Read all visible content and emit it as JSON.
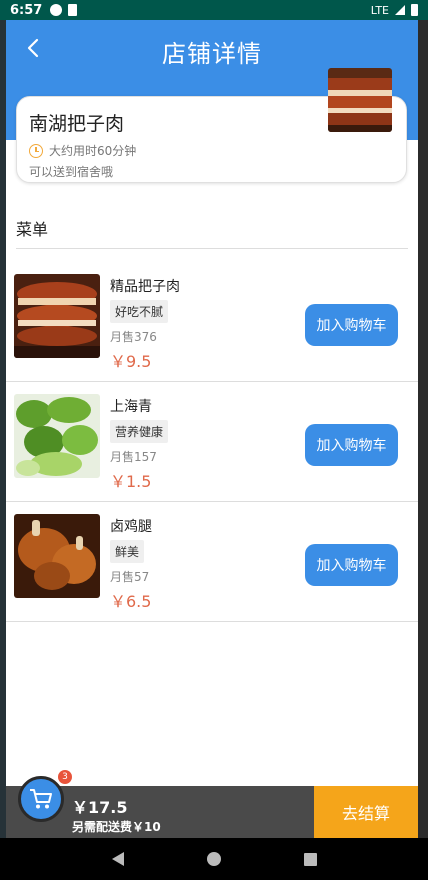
{
  "status": {
    "time": "6:57",
    "network": "LTE"
  },
  "header": {
    "title": "店铺详情"
  },
  "shop": {
    "name": "南湖把子肉",
    "time": "大约用时60分钟",
    "note": "可以送到宿舍哦"
  },
  "menu": {
    "title": "菜单"
  },
  "items": [
    {
      "name": "精品把子肉",
      "tag": "好吃不腻",
      "sold": "月售376",
      "price": "￥9.5",
      "button": "加入购物车"
    },
    {
      "name": "上海青",
      "tag": "营养健康",
      "sold": "月售157",
      "price": "￥1.5",
      "button": "加入购物车"
    },
    {
      "name": "卤鸡腿",
      "tag": "鲜美",
      "sold": "月售57",
      "price": "￥6.5",
      "button": "加入购物车"
    }
  ],
  "cart": {
    "badge": "3",
    "total": "￥17.5",
    "delivery": "另需配送费￥10",
    "checkout": "去结算"
  },
  "colors": {
    "primary": "#3b8ee6",
    "price": "#e06a4b",
    "checkout": "#f5a51a",
    "statusbar": "#00574B"
  },
  "icons": {
    "back": "arrow-left-icon",
    "clock": "clock-icon",
    "cart": "shopping-cart-icon"
  }
}
